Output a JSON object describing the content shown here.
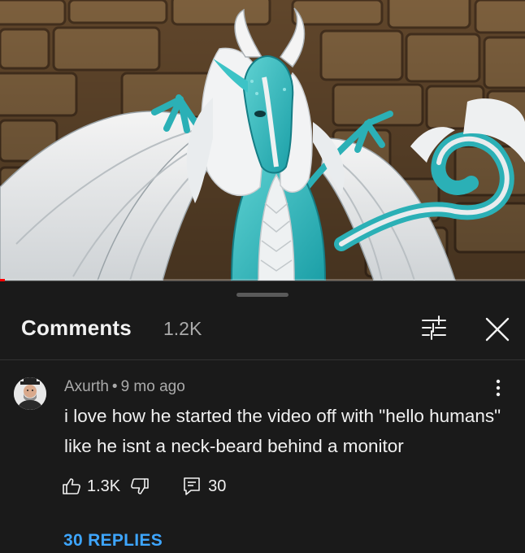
{
  "video": {
    "progress": 0.01,
    "progress_color": "#ff0000"
  },
  "comments_header": {
    "title": "Comments",
    "count": "1.2K",
    "filter_icon": "sort-filter-icon",
    "close_icon": "close-icon"
  },
  "comment": {
    "author": "Axurth",
    "separator": "•",
    "time": "9 mo ago",
    "text": "i love how he started the video off with \"hello humans\" like he isnt a neck-beard behind a monitor",
    "likes": "1.3K",
    "replies_count": "30",
    "replies_link": "30 REPLIES",
    "link_color": "#3ea6ff"
  }
}
